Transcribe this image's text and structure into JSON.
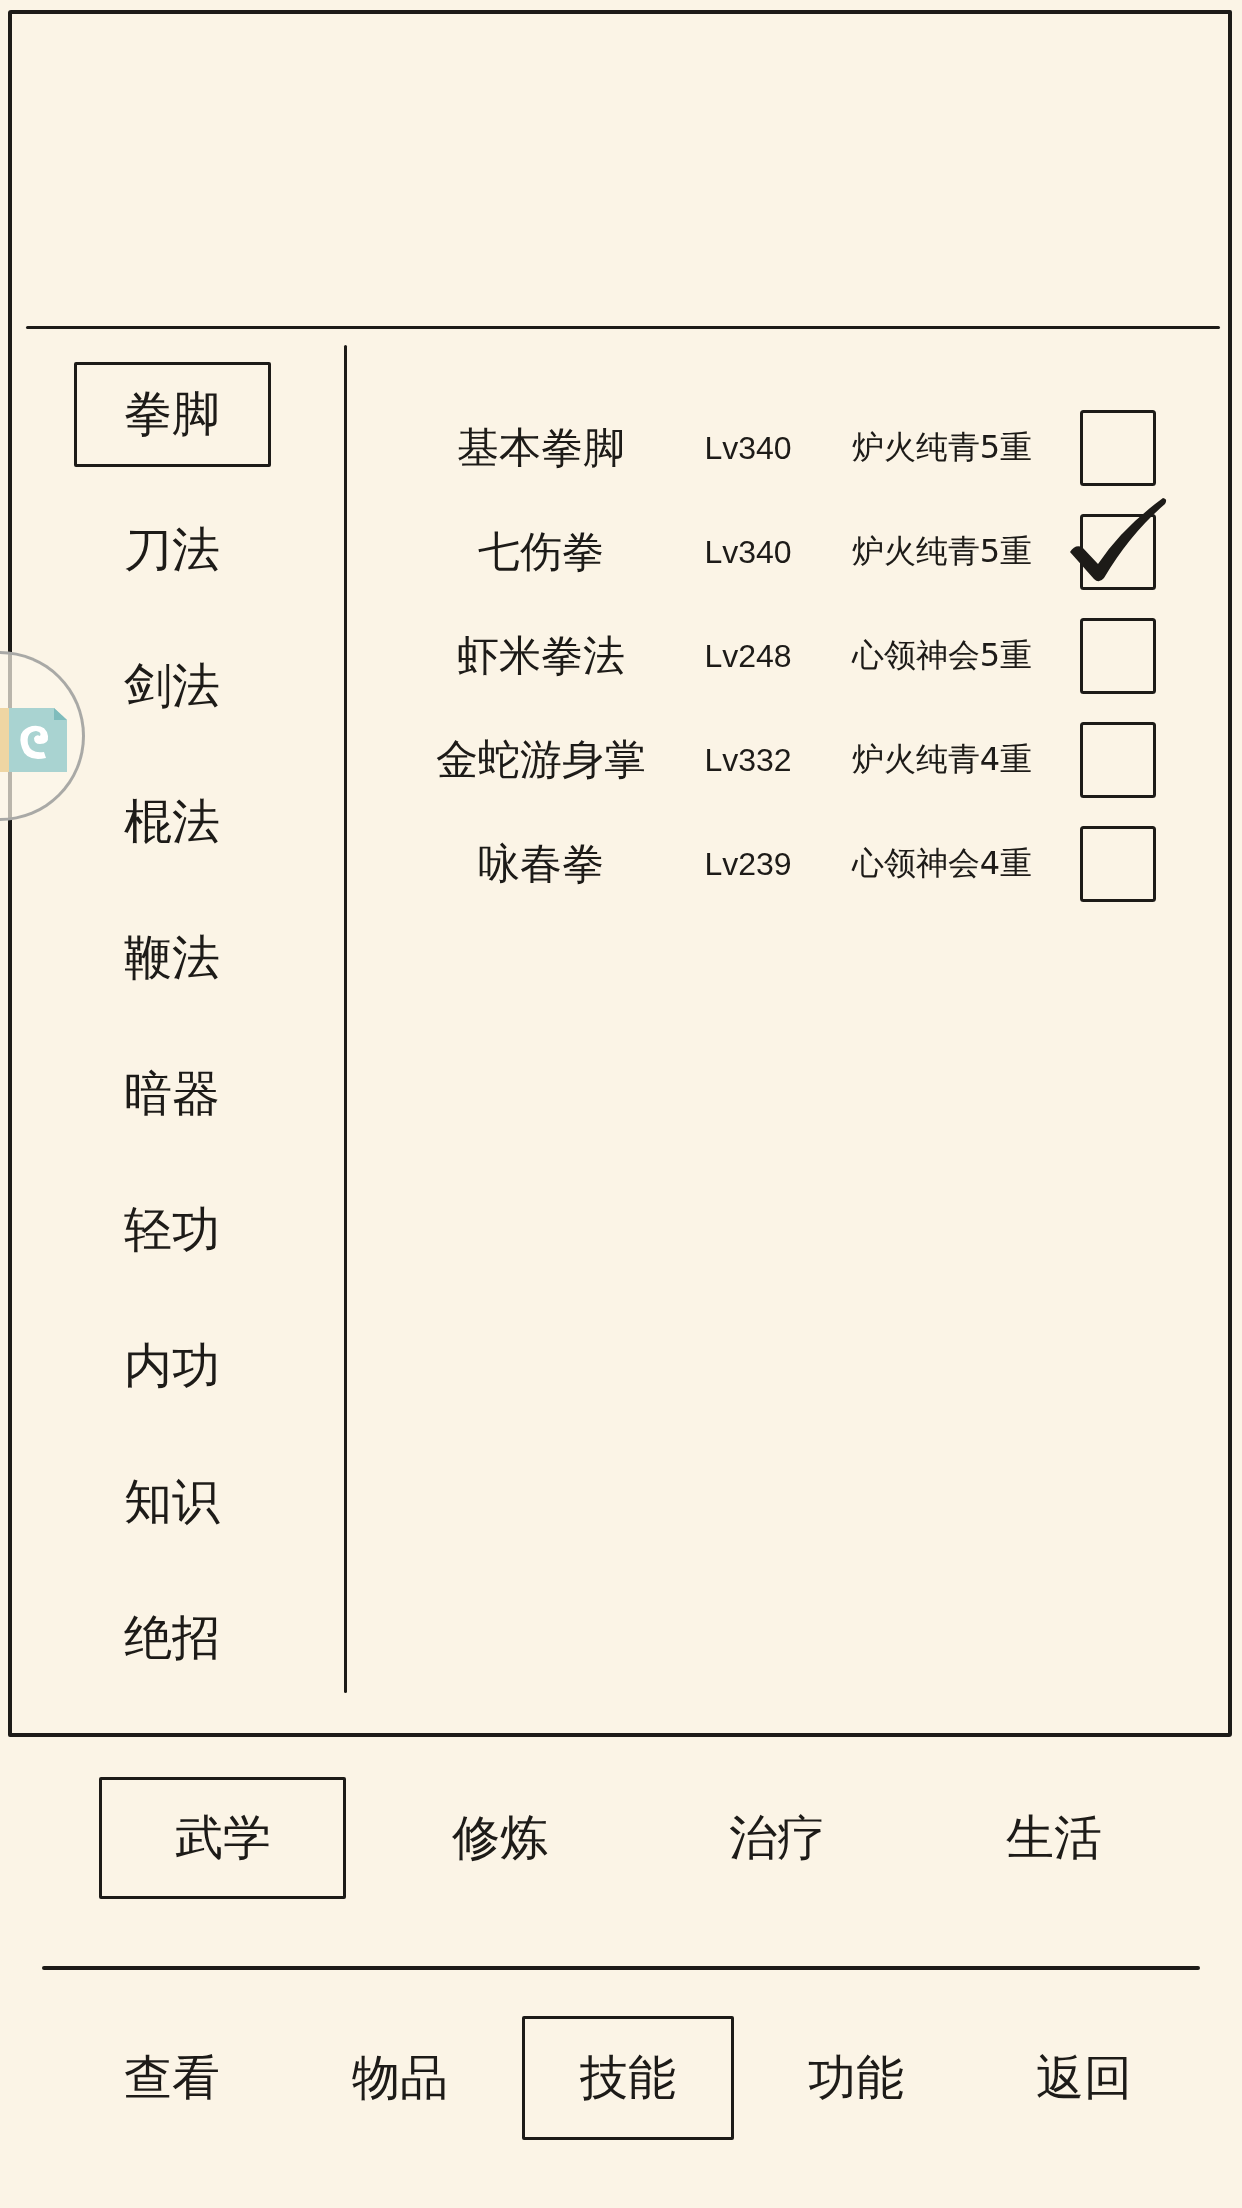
{
  "skill_panel": {
    "categories": [
      {
        "label": "拳脚",
        "selected": true
      },
      {
        "label": "刀法",
        "selected": false
      },
      {
        "label": "剑法",
        "selected": false
      },
      {
        "label": "棍法",
        "selected": false
      },
      {
        "label": "鞭法",
        "selected": false
      },
      {
        "label": "暗器",
        "selected": false
      },
      {
        "label": "轻功",
        "selected": false
      },
      {
        "label": "内功",
        "selected": false
      },
      {
        "label": "知识",
        "selected": false
      },
      {
        "label": "绝招",
        "selected": false
      }
    ],
    "skills": [
      {
        "name": "基本拳脚",
        "lv": "Lv340",
        "realm": "炉火纯青5重",
        "checked": false
      },
      {
        "name": "七伤拳",
        "lv": "Lv340",
        "realm": "炉火纯青5重",
        "checked": true
      },
      {
        "name": "虾米拳法",
        "lv": "Lv248",
        "realm": "心领神会5重",
        "checked": false
      },
      {
        "name": "金蛇游身掌",
        "lv": "Lv332",
        "realm": "炉火纯青4重",
        "checked": false
      },
      {
        "name": "咏春拳",
        "lv": "Lv239",
        "realm": "心领神会4重",
        "checked": false
      }
    ]
  },
  "section_tabs": [
    {
      "label": "武学",
      "selected": true
    },
    {
      "label": "修炼",
      "selected": false
    },
    {
      "label": "治疗",
      "selected": false
    },
    {
      "label": "生活",
      "selected": false
    }
  ],
  "nav_tabs": [
    {
      "label": "查看",
      "selected": false
    },
    {
      "label": "物品",
      "selected": false
    },
    {
      "label": "技能",
      "selected": true
    },
    {
      "label": "功能",
      "selected": false
    },
    {
      "label": "返回",
      "selected": false
    }
  ]
}
